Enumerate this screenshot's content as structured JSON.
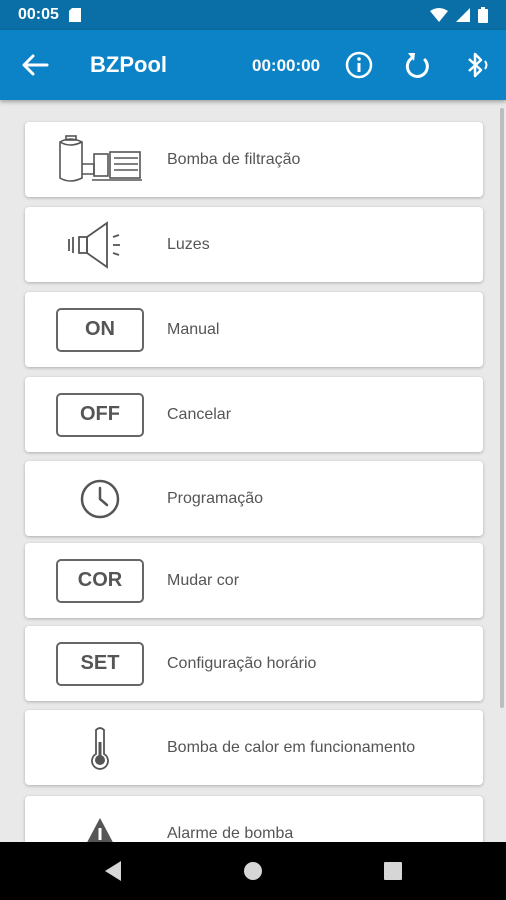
{
  "status_bar": {
    "time": "00:05"
  },
  "app_bar": {
    "title": "BZPool",
    "timer": "00:00:00"
  },
  "menu": {
    "items": [
      {
        "label": "Bomba de filtração",
        "icon": "pump-icon"
      },
      {
        "label": "Luzes",
        "icon": "speaker-icon"
      },
      {
        "label": "Manual",
        "icon": "on-tag",
        "tag": "ON"
      },
      {
        "label": "Cancelar",
        "icon": "off-tag",
        "tag": "OFF"
      },
      {
        "label": "Programação",
        "icon": "clock-icon"
      },
      {
        "label": "Mudar cor",
        "icon": "cor-tag",
        "tag": "COR"
      },
      {
        "label": "Configuração horário",
        "icon": "set-tag",
        "tag": "SET"
      },
      {
        "label": "Bomba de calor em funcionamento",
        "icon": "thermometer-icon"
      },
      {
        "label": "Alarme de bomba",
        "icon": "warning-icon"
      }
    ]
  }
}
